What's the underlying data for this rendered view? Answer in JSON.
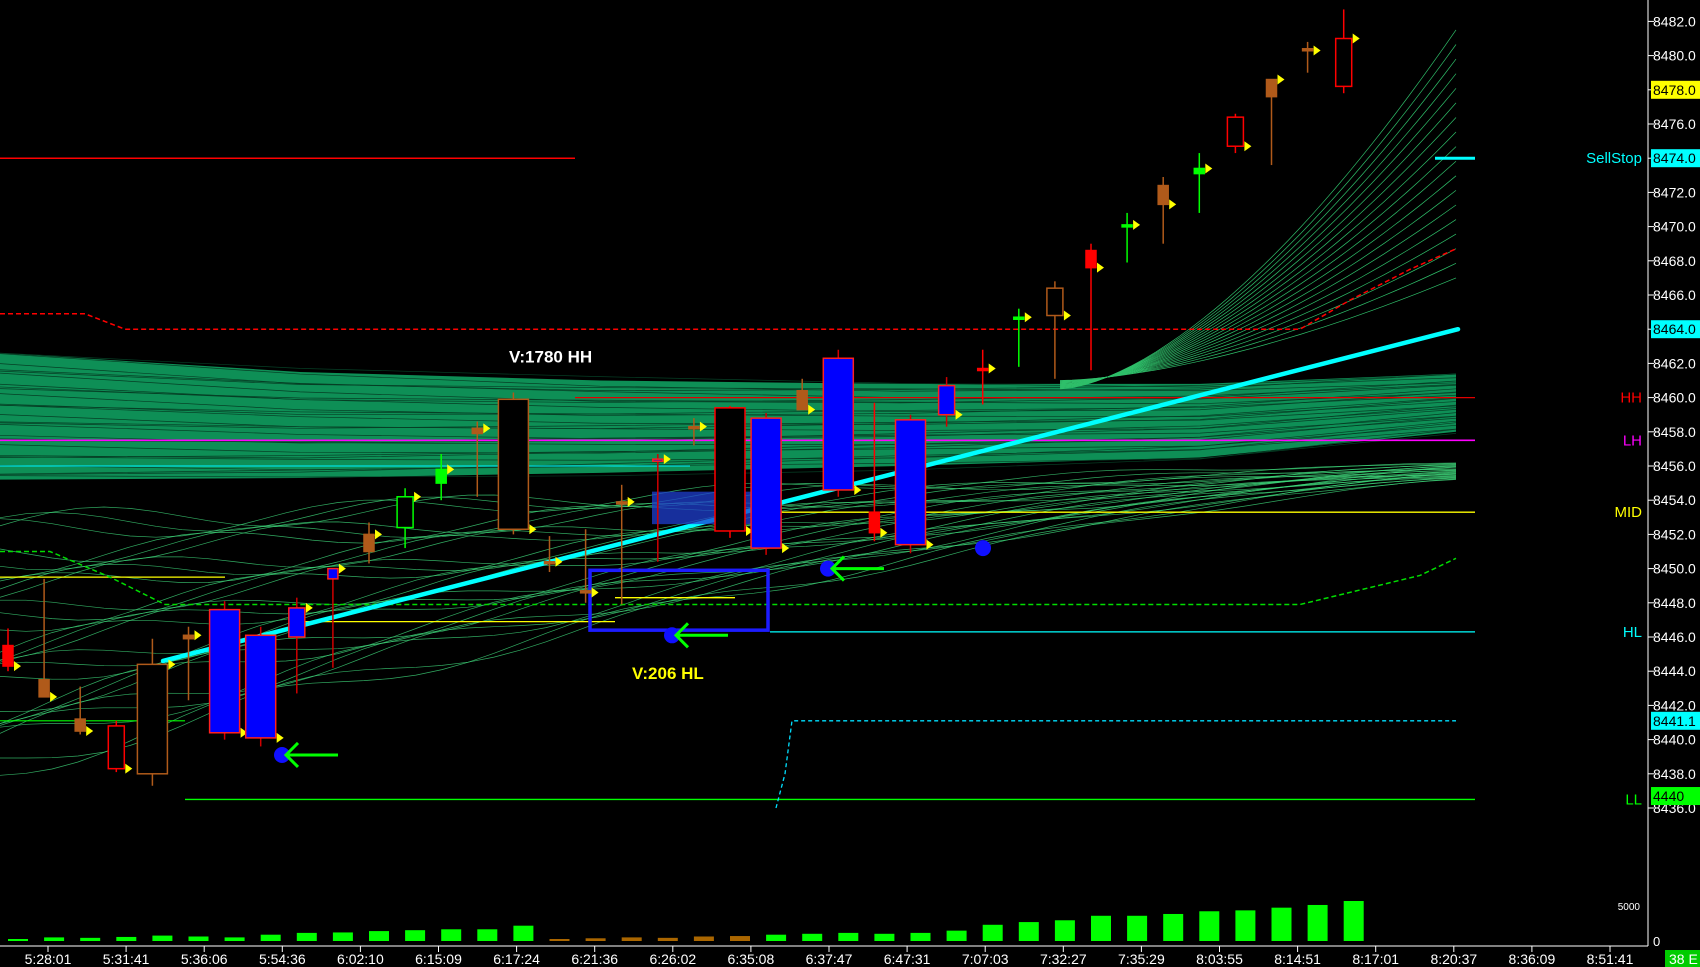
{
  "chart_data": {
    "type": "candlestick",
    "y_axis": {
      "min": 8434.8,
      "max": 8482.9,
      "ticks": [
        8436,
        8438,
        8440,
        8442,
        8444,
        8446,
        8448,
        8450,
        8452,
        8454,
        8456,
        8458,
        8460,
        8462,
        8464,
        8466,
        8468,
        8470,
        8472,
        8474,
        8476,
        8478,
        8480,
        8482
      ]
    },
    "time_labels": [
      "5:28:01",
      "5:31:41",
      "5:36:06",
      "5:54:36",
      "6:02:10",
      "6:15:09",
      "6:17:24",
      "6:21:36",
      "6:26:02",
      "6:35:08",
      "6:37:47",
      "6:47:31",
      "7:07:03",
      "7:32:27",
      "7:35:29",
      "8:03:55",
      "8:14:51",
      "8:17:01",
      "8:20:37",
      "8:36:09",
      "8:51:41"
    ],
    "price_badges": [
      {
        "text": "8478.0",
        "value": 8478.0,
        "bg": "#ffff00",
        "fg": "#000000"
      },
      {
        "text": "8474.0",
        "value": 8474.0,
        "bg": "#00ffff",
        "fg": "#000000"
      },
      {
        "text": "8464.0",
        "value": 8464.0,
        "bg": "#00ffff",
        "fg": "#000000"
      },
      {
        "text": "8441.1",
        "value": 8441.1,
        "bg": "#00ffff",
        "fg": "#000000"
      },
      {
        "text": "4440",
        "value": 8436.7,
        "bg": "#00ff00",
        "fg": "#000000"
      }
    ],
    "level_labels": [
      {
        "text": "SellStop",
        "value": 8474.0,
        "color": "#00ffff"
      },
      {
        "text": "HH",
        "value": 8460.0,
        "color": "#ff0000"
      },
      {
        "text": "LH",
        "value": 8457.5,
        "color": "#ff00ff"
      },
      {
        "text": "MID",
        "value": 8453.3,
        "color": "#ffff00"
      },
      {
        "text": "HL",
        "value": 8446.3,
        "color": "#00ffff"
      },
      {
        "text": "LL",
        "value": 8436.5,
        "color": "#00ff00"
      }
    ],
    "annotations": [
      {
        "text": "V:1780 HH",
        "value": 8462.4,
        "color": "#ffffff"
      },
      {
        "text": "V:206 HL",
        "value": 8443.9,
        "color": "#ffff00"
      }
    ],
    "volume_axis_label": "5000",
    "volume_zero_label": "0",
    "volume_corner_badge": "38 E",
    "levels": {
      "sellstop": 8474.0,
      "hh": 8460.0,
      "lh": 8457.5,
      "mid": 8453.3,
      "hl": 8446.3,
      "ll": 8436.5,
      "old_red": 8474.0,
      "old_cyan": 8456.0,
      "left_yellow": 8449.5,
      "left_green": 8441.1
    },
    "candles": [
      {
        "o": 8445.5,
        "h": 8446.5,
        "l": 8444.0,
        "c": 8444.3,
        "color": "red"
      },
      {
        "o": 8443.5,
        "h": 8449.4,
        "l": 8442.6,
        "c": 8442.5,
        "color": "brown"
      },
      {
        "o": 8441.2,
        "h": 8443.1,
        "l": 8440.3,
        "c": 8440.5,
        "color": "brown"
      },
      {
        "o": 8440.8,
        "h": 8441.1,
        "l": 8438.1,
        "c": 8438.3,
        "color": "red"
      },
      {
        "o": 8438.0,
        "h": 8445.9,
        "l": 8437.3,
        "c": 8444.4,
        "color": "brown"
      },
      {
        "o": 8445.9,
        "h": 8446.6,
        "l": 8442.3,
        "c": 8446.1,
        "color": "brown"
      },
      {
        "o": 8447.6,
        "h": 8448.1,
        "l": 8440.0,
        "c": 8440.4,
        "color": "blue"
      },
      {
        "o": 8446.1,
        "h": 8446.6,
        "l": 8439.6,
        "c": 8440.1,
        "color": "blue"
      },
      {
        "o": 8446.0,
        "h": 8448.3,
        "l": 8442.7,
        "c": 8447.7,
        "color": "blue"
      },
      {
        "o": 8449.4,
        "h": 8450.0,
        "l": 8444.2,
        "c": 8450.0,
        "color": "blue"
      },
      {
        "o": 8451.0,
        "h": 8452.7,
        "l": 8450.3,
        "c": 8452.0,
        "color": "brown"
      },
      {
        "o": 8452.4,
        "h": 8454.7,
        "l": 8451.2,
        "c": 8454.2,
        "color": "green"
      },
      {
        "o": 8455.0,
        "h": 8456.7,
        "l": 8454.0,
        "c": 8455.8,
        "color": "green"
      },
      {
        "o": 8457.9,
        "h": 8458.6,
        "l": 8454.2,
        "c": 8458.2,
        "color": "brown"
      },
      {
        "o": 8459.9,
        "h": 8460.3,
        "l": 8452.0,
        "c": 8452.3,
        "color": "black"
      },
      {
        "o": 8450.4,
        "h": 8451.9,
        "l": 8449.8,
        "c": 8450.4,
        "color": "brown"
      },
      {
        "o": 8448.7,
        "h": 8452.3,
        "l": 8448.0,
        "c": 8448.6,
        "color": "brown"
      },
      {
        "o": 8453.9,
        "h": 8454.9,
        "l": 8447.9,
        "c": 8453.9,
        "color": "brown"
      },
      {
        "o": 8456.4,
        "h": 8456.7,
        "l": 8450.4,
        "c": 8456.4,
        "color": "blue"
      },
      {
        "o": 8458.3,
        "h": 8458.8,
        "l": 8457.2,
        "c": 8458.3,
        "color": "brown"
      },
      {
        "o": 8459.4,
        "h": 8459.5,
        "l": 8451.8,
        "c": 8452.2,
        "color": "red"
      },
      {
        "o": 8458.8,
        "h": 8459.1,
        "l": 8450.8,
        "c": 8451.2,
        "color": "blue"
      },
      {
        "o": 8460.4,
        "h": 8461.1,
        "l": 8459.4,
        "c": 8459.3,
        "color": "brown"
      },
      {
        "o": 8462.3,
        "h": 8462.8,
        "l": 8454.2,
        "c": 8454.6,
        "color": "blue"
      },
      {
        "o": 8453.3,
        "h": 8459.7,
        "l": 8451.6,
        "c": 8452.1,
        "color": "red"
      },
      {
        "o": 8458.7,
        "h": 8459.0,
        "l": 8450.9,
        "c": 8451.4,
        "color": "blue"
      },
      {
        "o": 8460.7,
        "h": 8461.2,
        "l": 8458.3,
        "c": 8459.0,
        "color": "blue"
      },
      {
        "o": 8461.7,
        "h": 8462.8,
        "l": 8459.6,
        "c": 8461.7,
        "color": "red"
      },
      {
        "o": 8464.7,
        "h": 8465.2,
        "l": 8461.8,
        "c": 8464.7,
        "color": "green"
      },
      {
        "o": 8466.4,
        "h": 8466.8,
        "l": 8461.1,
        "c": 8464.8,
        "color": "brown"
      },
      {
        "o": 8468.6,
        "h": 8469.0,
        "l": 8461.6,
        "c": 8467.6,
        "color": "red"
      },
      {
        "o": 8470.1,
        "h": 8470.8,
        "l": 8467.9,
        "c": 8470.1,
        "color": "green"
      },
      {
        "o": 8472.4,
        "h": 8472.9,
        "l": 8469.0,
        "c": 8471.3,
        "color": "brown"
      },
      {
        "o": 8473.1,
        "h": 8474.3,
        "l": 8470.8,
        "c": 8473.4,
        "color": "green"
      },
      {
        "o": 8476.4,
        "h": 8476.6,
        "l": 8474.3,
        "c": 8474.7,
        "color": "red"
      },
      {
        "o": 8477.6,
        "h": 8478.6,
        "l": 8473.6,
        "c": 8478.6,
        "color": "brown"
      },
      {
        "o": 8480.4,
        "h": 8480.8,
        "l": 8479.0,
        "c": 8480.3,
        "color": "brown"
      },
      {
        "o": 8478.2,
        "h": 8482.7,
        "l": 8477.8,
        "c": 8481.0,
        "color": "red"
      }
    ],
    "volume": [
      200,
      400,
      350,
      450,
      600,
      500,
      400,
      700,
      900,
      950,
      1100,
      1200,
      1300,
      1300,
      1700,
      200,
      300,
      400,
      350,
      500,
      550,
      700,
      800,
      900,
      800,
      900,
      1150,
      1800,
      2100,
      2300,
      2800,
      2800,
      3000,
      3300,
      3400,
      3700,
      4000,
      4440
    ]
  }
}
